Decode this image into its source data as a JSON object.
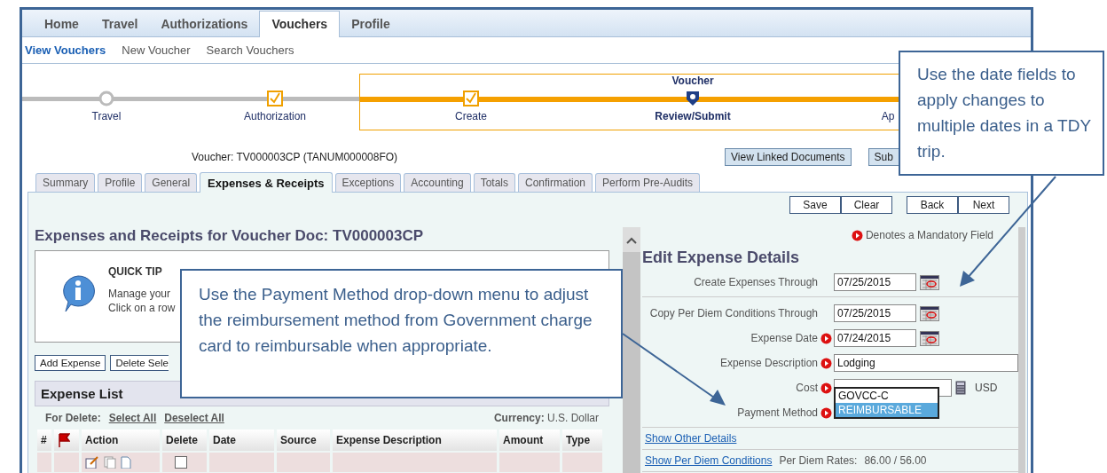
{
  "nav_tabs": [
    {
      "label": "Home",
      "selected": false
    },
    {
      "label": "Travel",
      "selected": false
    },
    {
      "label": "Authorizations",
      "selected": false
    },
    {
      "label": "Vouchers",
      "selected": true
    },
    {
      "label": "Profile",
      "selected": false
    }
  ],
  "sub_nav": [
    {
      "label": "View Vouchers",
      "selected": true
    },
    {
      "label": "New Voucher",
      "selected": false
    },
    {
      "label": "Search Vouchers",
      "selected": false
    }
  ],
  "progress": {
    "steps": [
      {
        "label": "Travel",
        "kind": "circle",
        "highlighted": false
      },
      {
        "label": "Authorization",
        "kind": "check",
        "highlighted": false
      },
      {
        "label": "Create",
        "kind": "check",
        "highlighted": true
      },
      {
        "title": "Voucher",
        "label": "Review/Submit",
        "kind": "current",
        "highlighted": true
      },
      {
        "label": "Ap",
        "kind": "none",
        "highlighted": true
      }
    ]
  },
  "voucher_line": "Voucher: TV000003CP (TANUM000008FO)",
  "header_buttons": [
    "View Linked Documents",
    "Sub"
  ],
  "doc_tabs": [
    {
      "label": "Summary",
      "selected": false
    },
    {
      "label": "Profile",
      "selected": false
    },
    {
      "label": "General",
      "selected": false
    },
    {
      "label": "Expenses & Receipts",
      "selected": true
    },
    {
      "label": "Exceptions",
      "selected": false
    },
    {
      "label": "Accounting",
      "selected": false
    },
    {
      "label": "Totals",
      "selected": false
    },
    {
      "label": "Confirmation",
      "selected": false
    },
    {
      "label": "Perform Pre-Audits",
      "selected": false
    }
  ],
  "action_buttons": [
    [
      "Save",
      "Clear"
    ],
    [
      "Back",
      "Next"
    ]
  ],
  "expenses": {
    "title": "Expenses and Receipts for Voucher Doc: TV000003CP",
    "quick_tip": {
      "title": "QUICK TIP",
      "lines": [
        "Manage your",
        "Click on a row"
      ]
    },
    "buttons": [
      "Add Expense",
      "Delete Sele"
    ],
    "list_title": "Expense List",
    "for_delete": "For Delete:",
    "links": [
      "Select All",
      "Deselect All"
    ],
    "currency_label": "Currency:",
    "currency": "U.S. Dollar",
    "columns": [
      {
        "kind": "text",
        "label": "#"
      },
      {
        "kind": "flag"
      },
      {
        "kind": "text",
        "label": "Action"
      },
      {
        "kind": "text",
        "label": "Delete"
      },
      {
        "kind": "text",
        "label": "Date"
      },
      {
        "kind": "text",
        "label": "Source"
      },
      {
        "kind": "text",
        "label": "Expense Description"
      },
      {
        "kind": "text",
        "label": "Amount"
      },
      {
        "kind": "text",
        "label": "Type"
      }
    ],
    "rows": [
      {
        "delete": false
      }
    ]
  },
  "edit": {
    "mandatory_note": "Denotes a Mandatory Field",
    "title": "Edit Expense Details",
    "fields": [
      {
        "kind": "date",
        "label": "Create Expenses Through",
        "value": "07/25/2015",
        "required": false
      },
      {
        "kind": "date",
        "label": "Copy Per Diem Conditions Through",
        "value": "07/25/2015",
        "required": false
      },
      {
        "kind": "date",
        "label": "Expense Date",
        "value": "07/24/2015",
        "required": true
      },
      {
        "kind": "text",
        "label": "Expense Description",
        "value": "Lodging",
        "required": true
      },
      {
        "kind": "money",
        "label": "Cost",
        "unit": "USD",
        "required": true
      },
      {
        "kind": "select",
        "label": "Payment Method",
        "required": true,
        "options": [
          {
            "label": "GOVCC-C",
            "selected": false
          },
          {
            "label": "REIMBURSABLE",
            "selected": true
          }
        ]
      }
    ],
    "links": [
      "Show Other Details",
      "Show Per Diem Conditions"
    ],
    "rates_label": "Per Diem Rates:",
    "rates": "86.00 / 56.00"
  },
  "callouts": [
    {
      "text": "Use the date fields to apply changes to multiple dates in a TDY trip."
    },
    {
      "text": "Use the Payment Method drop-down menu to adjust the reimbursement method from Government charge card to reimbursable when appropriate."
    }
  ]
}
